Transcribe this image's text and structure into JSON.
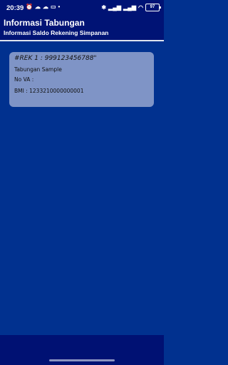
{
  "status_bar": {
    "time": "20:39",
    "left_icons": [
      "alarm-off-icon",
      "cloud-icon",
      "cloud-icon",
      "laptop-icon",
      "dot-icon"
    ],
    "right_icons": [
      "bluetooth-icon",
      "signal-icon",
      "signal-icon",
      "wifi-icon"
    ],
    "battery": "97"
  },
  "app_bar": {
    "title": "Informasi Tabungan",
    "subtitle": "Informasi Saldo Rekening Simpanan"
  },
  "account_card": {
    "rek": "#REK 1 : 999123456788\"",
    "name": "Tabungan Sample",
    "va": "No VA :",
    "bmi": "BMI : 1233210000000001"
  },
  "colors": {
    "background": "#01318f",
    "app_bar": "#001375",
    "card": "#7f94c6",
    "bottom_bar": "#001173"
  }
}
